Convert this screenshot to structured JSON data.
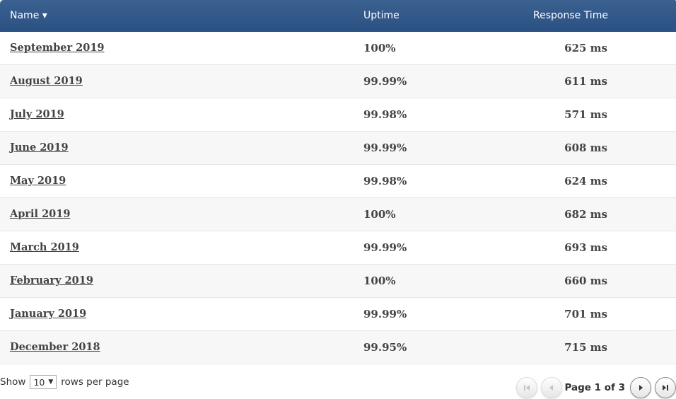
{
  "table": {
    "columns": [
      {
        "label": "Name ▾",
        "sorted": "desc"
      },
      {
        "label": "Uptime"
      },
      {
        "label": "Response Time"
      }
    ],
    "rows": [
      {
        "name": "September 2019",
        "uptime": "100%",
        "response": "625 ms"
      },
      {
        "name": "August 2019",
        "uptime": "99.99%",
        "response": "611 ms"
      },
      {
        "name": "July 2019",
        "uptime": "99.98%",
        "response": "571 ms"
      },
      {
        "name": "June 2019",
        "uptime": "99.99%",
        "response": "608 ms"
      },
      {
        "name": "May 2019",
        "uptime": "99.98%",
        "response": "624 ms"
      },
      {
        "name": "April 2019",
        "uptime": "100%",
        "response": "682 ms"
      },
      {
        "name": "March 2019",
        "uptime": "99.99%",
        "response": "693 ms"
      },
      {
        "name": "February 2019",
        "uptime": "100%",
        "response": "660 ms"
      },
      {
        "name": "January 2019",
        "uptime": "99.99%",
        "response": "701 ms"
      },
      {
        "name": "December 2018",
        "uptime": "99.95%",
        "response": "715 ms"
      }
    ]
  },
  "footer": {
    "show_label": "Show",
    "rows_per_page_value": "10",
    "rows_per_page_label": "rows per page",
    "page_info": "Page 1 of 3",
    "icons": {
      "first": "⏮",
      "prev": "◀",
      "next": "▶",
      "last": "⏭"
    }
  }
}
